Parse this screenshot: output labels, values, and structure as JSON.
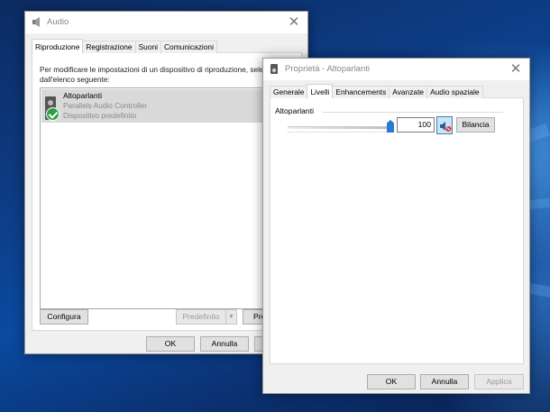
{
  "audio_window": {
    "title": "Audio",
    "tabs": [
      "Riproduzione",
      "Registrazione",
      "Suoni",
      "Comunicazioni"
    ],
    "active_tab": 0,
    "instruction_line1": "Per modificare le impostazioni di un dispositivo di riproduzione, seleziona",
    "instruction_line2": "dall'elenco seguente:",
    "device": {
      "name": "Altoparlanti",
      "controller": "Parallels Audio Controller",
      "status": "Dispositivo predefinito",
      "icon": "speaker-icon",
      "badge_icon": "checkmark-icon"
    },
    "configure_label": "Configura",
    "default_label": "Predefinito",
    "properties_label": "Pro",
    "ok_label": "OK",
    "cancel_label": "Annulla"
  },
  "props_window": {
    "title": "Proprietà - Altoparlanti",
    "tabs": [
      "Generale",
      "Livelli",
      "Enhancements",
      "Avanzate",
      "Audio spaziale"
    ],
    "active_tab": 1,
    "group_label": "Altoparlanti",
    "volume_value": "100",
    "volume_level": 1.0,
    "mute_icon": "speaker-muted-icon",
    "balance_label": "Bilancia",
    "ok_label": "OK",
    "cancel_label": "Annulla",
    "apply_label": "Applica"
  },
  "colors": {
    "accent": "#0078d7",
    "desktop_blue": "#0d3d86",
    "check_green": "#2f9e41",
    "selection_gray": "#d9d9d9"
  }
}
